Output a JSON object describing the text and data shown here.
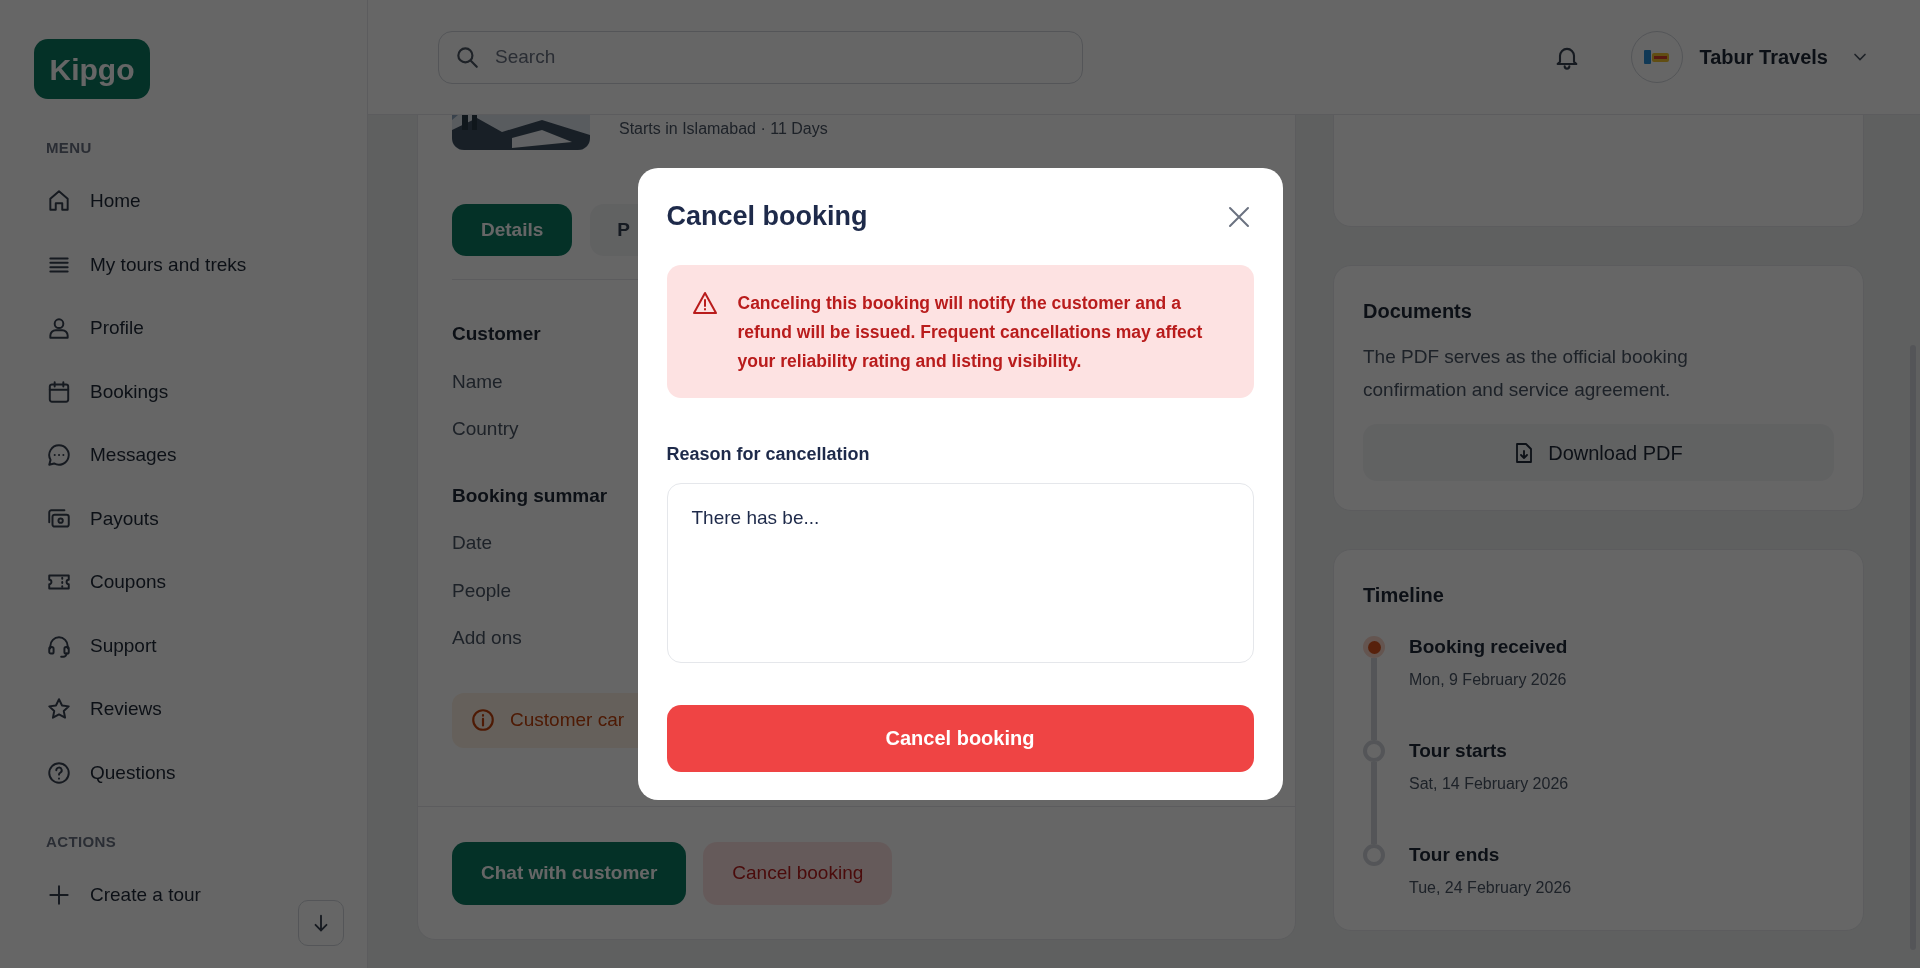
{
  "logo": "Kipgo",
  "sidebar": {
    "sections": [
      {
        "title": "MENU",
        "items": [
          {
            "label": "Home",
            "kind": "home"
          },
          {
            "label": "My tours and treks",
            "kind": "list"
          },
          {
            "label": "Profile",
            "kind": "person"
          },
          {
            "label": "Bookings",
            "kind": "calendar"
          },
          {
            "label": "Messages",
            "kind": "chat"
          },
          {
            "label": "Payouts",
            "kind": "cash"
          },
          {
            "label": "Coupons",
            "kind": "ticket"
          },
          {
            "label": "Support",
            "kind": "headset"
          },
          {
            "label": "Reviews",
            "kind": "star"
          },
          {
            "label": "Questions",
            "kind": "question"
          }
        ]
      },
      {
        "title": "ACTIONS",
        "items": [
          {
            "label": "Create a tour",
            "kind": "plus"
          }
        ]
      }
    ]
  },
  "header": {
    "search_placeholder": "Search",
    "account": "Tabur Travels"
  },
  "booking": {
    "subtitle": "Starts in Islamabad · 11 Days",
    "tabs": [
      {
        "label": "Details",
        "selected": true
      },
      {
        "label": "P",
        "selected": false
      }
    ],
    "sections": [
      {
        "title": "Customer",
        "fields": [
          "Name",
          "Country"
        ]
      },
      {
        "title": "Booking summar",
        "fields": [
          "Date",
          "People",
          "Add ons"
        ]
      }
    ],
    "notice": "Customer car",
    "actions": [
      {
        "label": "Chat with customer",
        "kind": "primary"
      },
      {
        "label": "Cancel booking",
        "kind": "danger"
      }
    ]
  },
  "documents": {
    "title": "Documents",
    "text": "The PDF serves as the official booking confirmation and service agreement.",
    "button": "Download PDF"
  },
  "timeline": {
    "title": "Timeline",
    "events": [
      {
        "label": "Booking received",
        "date": "Mon, 9 February 2026",
        "done": true
      },
      {
        "label": "Tour starts",
        "date": "Sat, 14 February 2026",
        "done": false
      },
      {
        "label": "Tour ends",
        "date": "Tue, 24 February 2026",
        "done": false
      }
    ]
  },
  "modal": {
    "title": "Cancel booking",
    "warning": "Canceling this booking will notify the customer and a refund will be issued. Frequent cancellations may affect your reliability rating and listing visibility.",
    "field_label": "Reason for cancellation",
    "reason": "There has be...",
    "submit": "Cancel booking"
  }
}
